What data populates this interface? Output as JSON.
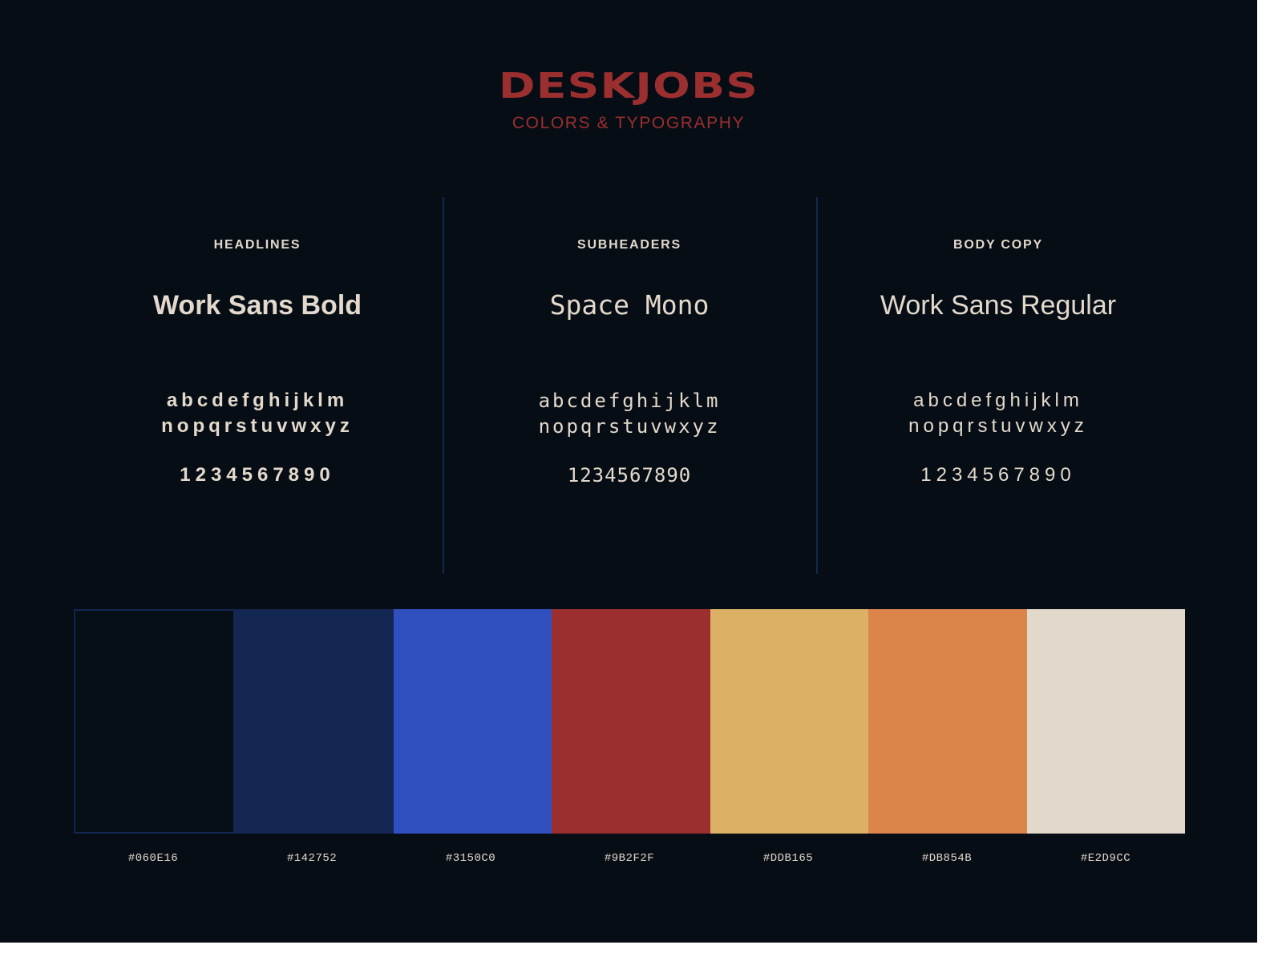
{
  "header": {
    "brand": "DESKJOBS",
    "subtitle": "COLORS & TYPOGRAPHY"
  },
  "typography": [
    {
      "label": "HEADLINES",
      "font_name": "Work Sans Bold",
      "alphabet_line1": "abcdefghijklm",
      "alphabet_line2": "nopqrstuvwxyz",
      "digits": "1234567890"
    },
    {
      "label": "SUBHEADERS",
      "font_name": "Space Mono",
      "alphabet_line1": "abcdefghijklm",
      "alphabet_line2": "nopqrstuvwxyz",
      "digits": "1234567890"
    },
    {
      "label": "BODY COPY",
      "font_name": "Work Sans Regular",
      "alphabet_line1": "abcdefghijklm",
      "alphabet_line2": "nopqrstuvwxyz",
      "digits": "1234567890"
    }
  ],
  "colors": {
    "background": "#060E16",
    "accent": "#9B2F2F",
    "text": "#E2D9CC",
    "divider": "#142752"
  },
  "palette": [
    {
      "hex": "#060E16",
      "label": "#060E16"
    },
    {
      "hex": "#142752",
      "label": "#142752"
    },
    {
      "hex": "#3150C0",
      "label": "#3150C0"
    },
    {
      "hex": "#9B2F2F",
      "label": "#9B2F2F"
    },
    {
      "hex": "#DDB165",
      "label": "#DDB165"
    },
    {
      "hex": "#DB854B",
      "label": "#DB854B"
    },
    {
      "hex": "#E2D9CC",
      "label": "#E2D9CC"
    }
  ]
}
